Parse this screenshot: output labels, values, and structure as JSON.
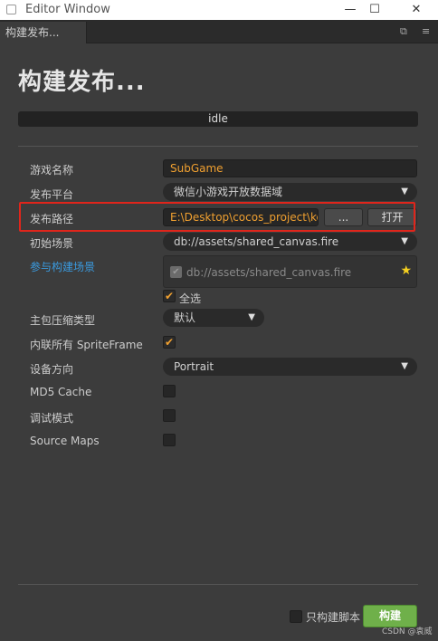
{
  "window": {
    "title": "Editor Window",
    "minimize": "—",
    "maximize": "☐",
    "close": "✕"
  },
  "tab": {
    "label": "构建发布...",
    "icons": [
      "popout-icon",
      "menu-icon"
    ]
  },
  "heading": "构建发布...",
  "status": "idle",
  "form": {
    "game_name": {
      "label": "游戏名称",
      "value": "SubGame"
    },
    "platform": {
      "label": "发布平台",
      "value": "微信小游戏开放数据域"
    },
    "publish_path": {
      "label": "发布路径",
      "value": "E:\\Desktop\\cocos_project\\kong",
      "browse_label": "...",
      "open_label": "打开"
    },
    "start_scene": {
      "label": "初始场景",
      "value": "db://assets/shared_canvas.fire"
    },
    "included_scenes": {
      "label": "参与构建场景",
      "item": "db://assets/shared_canvas.fire",
      "select_all_label": "全选",
      "select_all_checked": true
    },
    "compression": {
      "label": "主包压缩类型",
      "value": "默认"
    },
    "inline_spriteframe": {
      "label": "内联所有 SpriteFrame",
      "checked": true
    },
    "orientation": {
      "label": "设备方向",
      "value": "Portrait"
    },
    "md5_cache": {
      "label": "MD5 Cache",
      "checked": false
    },
    "debug_mode": {
      "label": "调试模式",
      "checked": false
    },
    "source_maps": {
      "label": "Source Maps",
      "checked": false
    }
  },
  "footer": {
    "build_script_only_label": "只构建脚本",
    "build_script_only_checked": false,
    "build_button": "构建"
  },
  "watermark": "CSDN @袁威",
  "colors": {
    "accent_orange": "#f0a030",
    "link_blue": "#3a9be0",
    "build_green": "#6fb04a",
    "highlight_red": "#e0251b"
  }
}
